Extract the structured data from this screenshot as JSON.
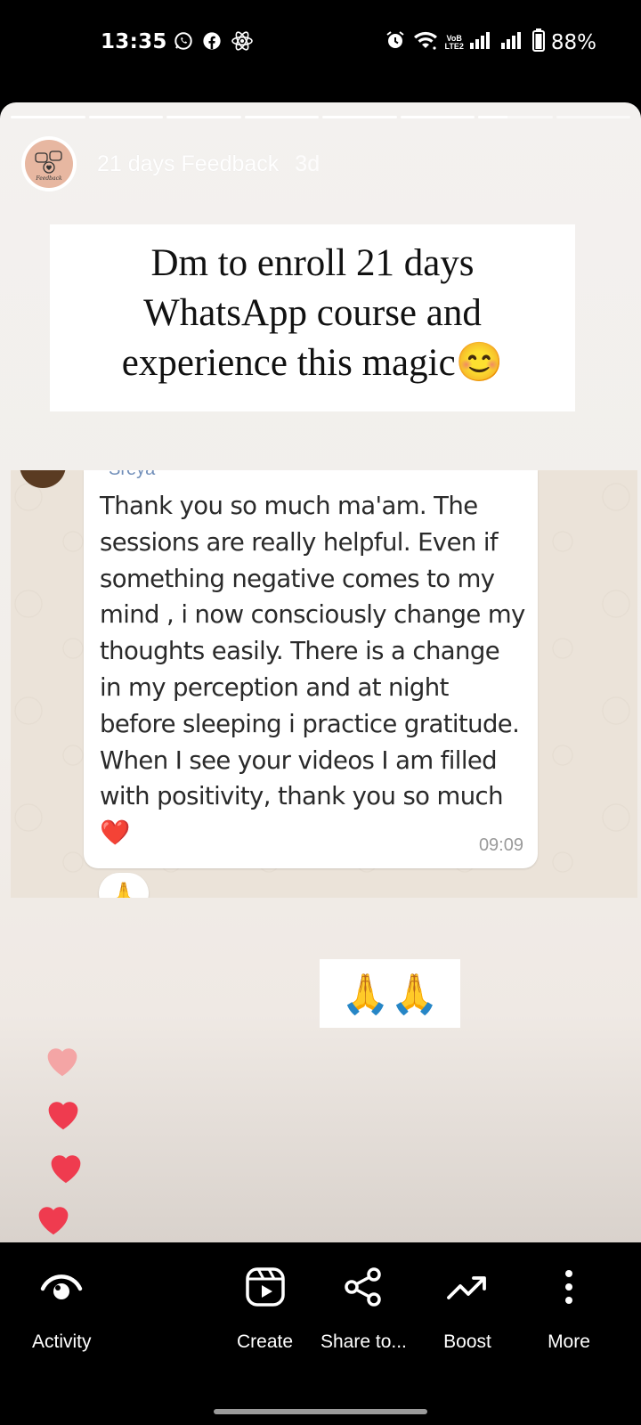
{
  "status_bar": {
    "time": "13:35",
    "left_icons": [
      "whatsapp-icon",
      "facebook-icon",
      "react-icon"
    ],
    "right_icons": [
      "alarm-icon",
      "wifi-icon",
      "volte-icon",
      "signal-icon",
      "signal-icon",
      "battery-icon"
    ],
    "volte_top": "VoB",
    "volte_bottom": "LTE2",
    "battery": "88%"
  },
  "story": {
    "progress": {
      "segments": 8,
      "completed": 6,
      "current_fraction": 0.4
    },
    "username": "21 days Feedback",
    "age": "3d",
    "avatar_text": "Feedback",
    "caption_lines": [
      "Dm to enroll 21 days",
      "WhatsApp course and",
      "experience this magic😊"
    ],
    "chat_screenshot": {
      "sender_cut": "Sreya",
      "message": "Thank you so much ma'am. The sessions are really helpful. Even if something negative comes to my mind , i now consciously change my thoughts easily. There is a change in my perception and at night before sleeping i practice gratitude. When I see your videos I am filled with positivity, thank you so much ❤️",
      "time": "09:09",
      "reaction": "🙏"
    },
    "sticker": "🙏🙏",
    "hearts": [
      "heart-icon",
      "heart-icon",
      "heart-icon",
      "heart-icon"
    ],
    "heart_colors": [
      "#f4a5a5",
      "#ef3b4f",
      "#ef3b4f",
      "#ef3b4f"
    ]
  },
  "bottom_bar": {
    "actions": [
      {
        "label": "Activity",
        "icon": "eye-icon"
      },
      {
        "label": "Create",
        "icon": "reels-icon"
      },
      {
        "label": "Share to...",
        "icon": "share-icon"
      },
      {
        "label": "Boost",
        "icon": "trend-up-icon"
      },
      {
        "label": "More",
        "icon": "more-vertical-icon"
      }
    ]
  }
}
